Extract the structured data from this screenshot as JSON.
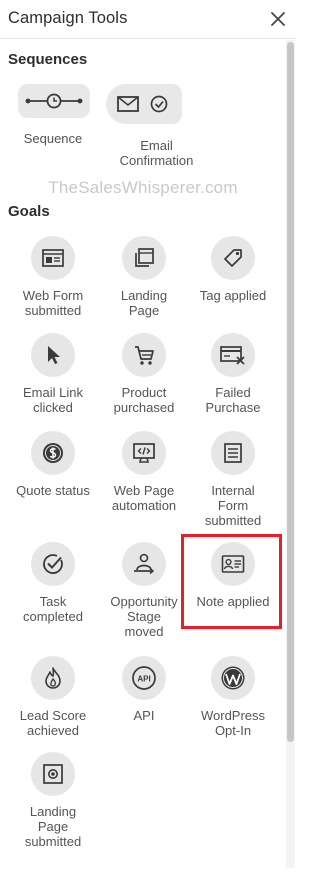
{
  "header": {
    "title": "Campaign Tools"
  },
  "sections": {
    "sequences_heading": "Sequences",
    "goals_heading": "Goals"
  },
  "sequences": [
    {
      "label": "Sequence",
      "icon": "sequence-timeline-icon"
    },
    {
      "label": "Email\nConfirmation",
      "icon": "email-check-icon"
    }
  ],
  "watermark": "TheSalesWhisperer.com",
  "goals": [
    {
      "label": "Web Form\nsubmitted",
      "icon": "web-form-icon"
    },
    {
      "label": "Landing\nPage",
      "icon": "landing-page-icon"
    },
    {
      "label": "Tag applied",
      "icon": "tag-icon"
    },
    {
      "label": "Email Link\nclicked",
      "icon": "cursor-icon"
    },
    {
      "label": "Product\npurchased",
      "icon": "cart-icon"
    },
    {
      "label": "Failed\nPurchase",
      "icon": "failed-card-icon"
    },
    {
      "label": "Quote status",
      "icon": "dollar-icon"
    },
    {
      "label": "Web Page\nautomation",
      "icon": "code-monitor-icon"
    },
    {
      "label": "Internal\nForm\nsubmitted",
      "icon": "document-icon"
    },
    {
      "label": "Task\ncompleted",
      "icon": "task-check-icon"
    },
    {
      "label": "Opportunity\nStage\nmoved",
      "icon": "opportunity-stage-icon"
    },
    {
      "label": "Note applied",
      "icon": "note-card-icon"
    },
    {
      "label": "Lead Score\nachieved",
      "icon": "flame-icon"
    },
    {
      "label": "API",
      "icon": "api-icon"
    },
    {
      "label": "WordPress\nOpt-In",
      "icon": "wordpress-icon"
    },
    {
      "label": "Landing\nPage\nsubmitted",
      "icon": "landing-submit-icon"
    }
  ],
  "colors": {
    "highlight": "#e4202a",
    "tile_bg": "#e6e6e6",
    "icon": "#3a3a3a"
  }
}
